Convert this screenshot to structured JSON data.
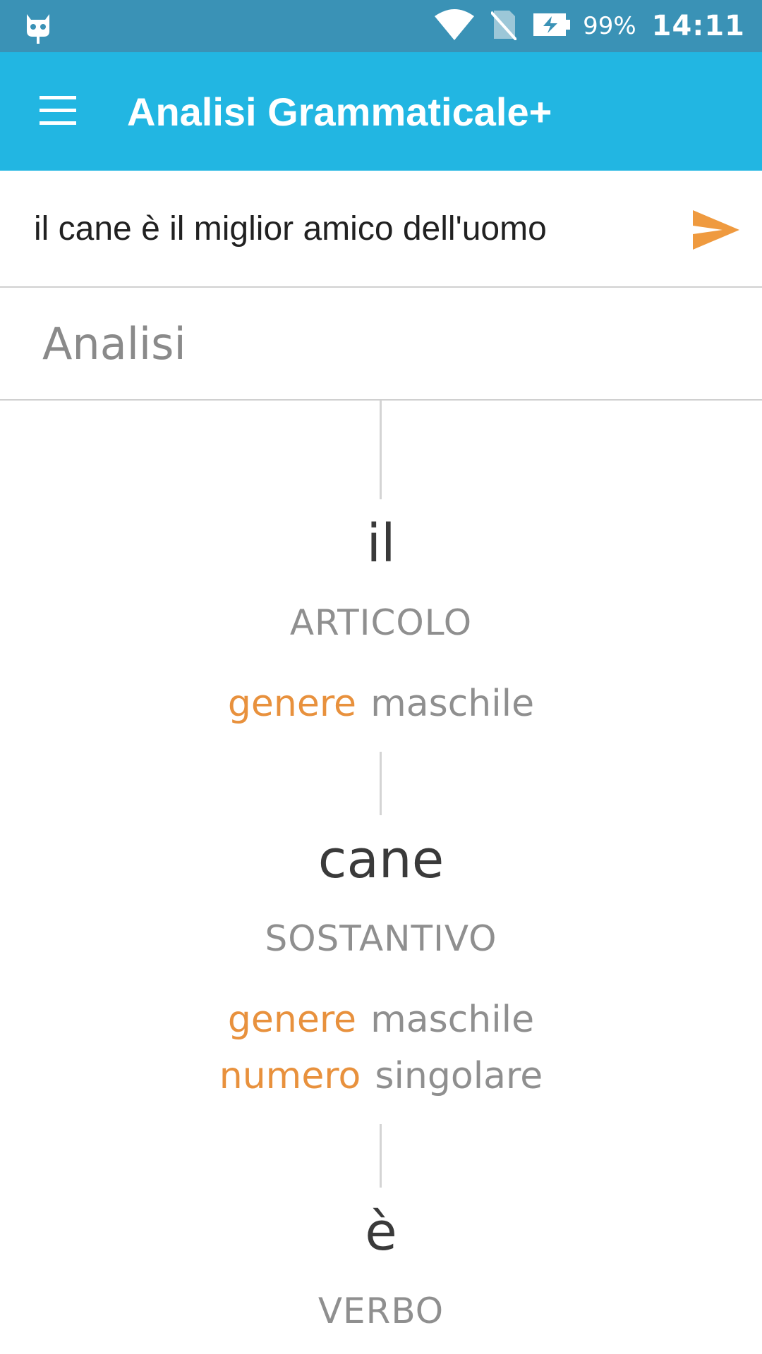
{
  "status_bar": {
    "left_icon": "cyanogen-bot-icon",
    "icons": [
      "wifi-icon",
      "no-sim-icon",
      "battery-charging-icon"
    ],
    "battery": "99%",
    "time": "14:11"
  },
  "app_bar": {
    "menu_icon": "hamburger-menu-icon",
    "title": "Analisi Grammaticale+"
  },
  "input": {
    "value": "il cane è il miglior amico dell'uomo",
    "send_icon": "send-icon",
    "accent": "#ef9a3f"
  },
  "section": {
    "title": "Analisi"
  },
  "analysis": [
    {
      "word": "il",
      "pos": "ARTICOLO",
      "attributes": [
        {
          "key": "genere",
          "value": "maschile"
        }
      ]
    },
    {
      "word": "cane",
      "pos": "SOSTANTIVO",
      "attributes": [
        {
          "key": "genere",
          "value": "maschile"
        },
        {
          "key": "numero",
          "value": "singolare"
        }
      ]
    },
    {
      "word": "è",
      "pos": "VERBO",
      "attributes": []
    }
  ],
  "colors": {
    "status_bar": "#3a92b6",
    "app_bar": "#22b6e2",
    "attribute_key": "#e8913d",
    "attribute_value": "#8f8f8f"
  }
}
